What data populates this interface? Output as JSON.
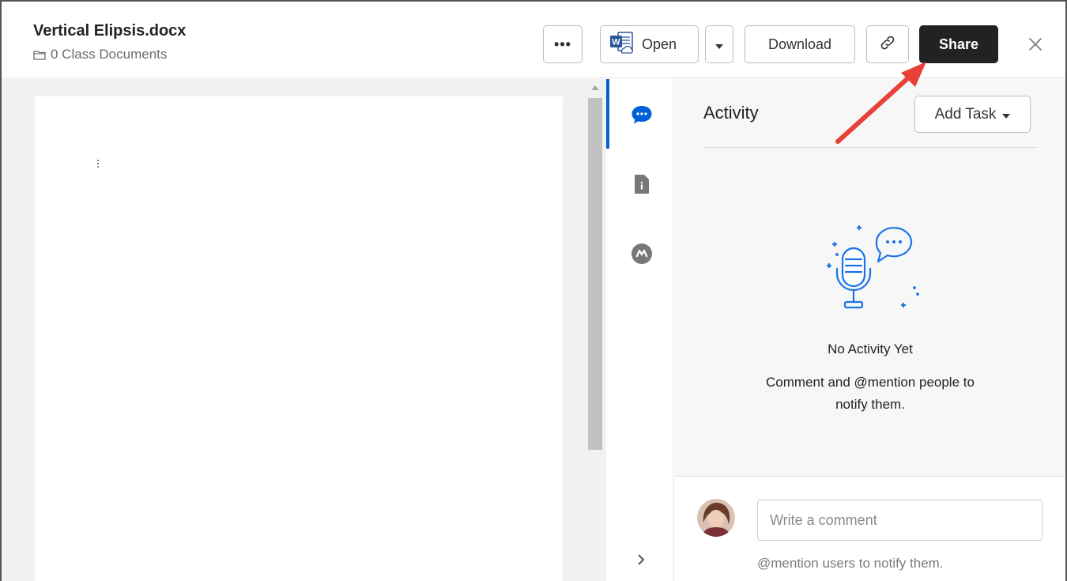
{
  "file": {
    "title": "Vertical Elipsis.docx",
    "folder": "0 Class Documents"
  },
  "toolbar": {
    "more_label": "•••",
    "open_label": "Open",
    "download_label": "Download",
    "share_label": "Share"
  },
  "panel": {
    "title": "Activity",
    "add_task_label": "Add Task",
    "empty_title": "No Activity Yet",
    "empty_description": "Comment and @mention people to notify them."
  },
  "comment": {
    "placeholder": "Write a comment",
    "hint": "@mention users to notify them."
  },
  "icons": {
    "rail": [
      "activity-icon",
      "file-info-icon",
      "metadata-icon"
    ],
    "toolbar": [
      "more-icon",
      "word-icon",
      "caret-down-icon",
      "link-icon",
      "close-icon"
    ]
  },
  "colors": {
    "accent": "#0061d5",
    "share_button": "#222222",
    "annotation_arrow": "#e8413a"
  }
}
